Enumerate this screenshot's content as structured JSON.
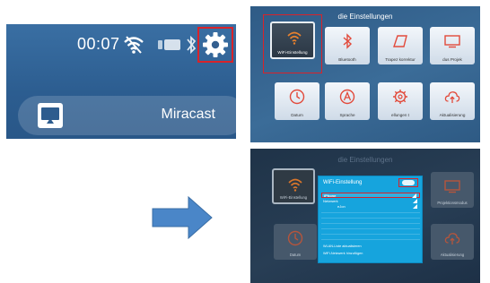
{
  "panel1": {
    "time": "00:07",
    "miracast_label": "Miracast",
    "icons": [
      "wifi-icon",
      "battery-icon",
      "bluetooth-icon",
      "gear-icon",
      "cast-icon"
    ]
  },
  "panel2": {
    "title": "die Einstellungen",
    "tiles": [
      {
        "label": "WiFi-Einstellung",
        "icon": "wifi-icon"
      },
      {
        "label": "Bluetooth",
        "icon": "bluetooth-icon"
      },
      {
        "label": "Trapez korrektur",
        "icon": "keystone-icon"
      },
      {
        "label": "dus      Projek",
        "icon": "projection-icon"
      },
      {
        "label": "Datum",
        "icon": "clock-icon"
      },
      {
        "label": "Sprache",
        "icon": "language-icon"
      },
      {
        "label": "ellungen      t",
        "icon": "settings-icon"
      },
      {
        "label": "Aktualisierung",
        "icon": "cloud-update-icon"
      }
    ]
  },
  "panel3": {
    "title": "die Einstellungen",
    "tiles": [
      {
        "label": "WiFi-Einstellung",
        "icon": "wifi-icon"
      },
      {
        "label": "Projektionsmodus",
        "icon": "projection-icon"
      },
      {
        "label": "Datum",
        "icon": "clock-icon"
      },
      {
        "label": "Aktualisierung",
        "icon": "cloud-update-icon"
      }
    ],
    "wifi_panel": {
      "title": "WiFi-Einstellung",
      "networks": [
        "iPhone",
        "Netzwerk",
        "eJon"
      ],
      "actions": [
        "WLAN-Liste aktualisieren",
        "WiFi-Netzwerk hinzufügen"
      ]
    }
  },
  "colors": {
    "accent_red": "#d8232a",
    "wifi_panel_blue": "#16a4dd",
    "arrow_blue": "#4a86c8"
  }
}
